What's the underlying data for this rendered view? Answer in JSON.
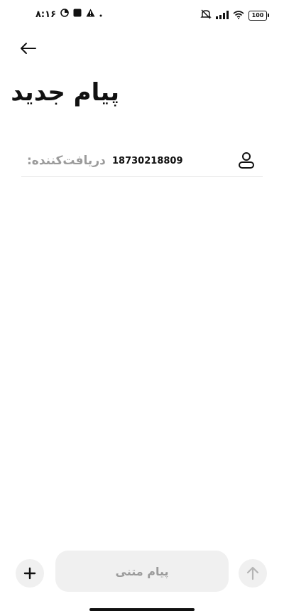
{
  "status_bar": {
    "time": "۸:۱۶",
    "battery": "100",
    "icons": [
      "data-saver-icon",
      "square-notification-icon",
      "warning-icon",
      "dot-icon",
      "mute-icon",
      "signal-icon",
      "wifi-icon",
      "battery-icon"
    ]
  },
  "header": {
    "back_icon": "arrow-left-icon",
    "title": "پیام جدید"
  },
  "recipient": {
    "label": "دریافت‌کننده:",
    "value": "18730218809",
    "icon": "person-icon"
  },
  "composer": {
    "attach_icon": "plus-icon",
    "placeholder": "پیام متنی",
    "value": "",
    "send_icon": "arrow-up-icon"
  },
  "colors": {
    "background": "#ffffff",
    "text": "#111111",
    "muted": "#9b9b9b",
    "field_bg": "#f0f0f0",
    "divider": "#e6e6e6"
  }
}
